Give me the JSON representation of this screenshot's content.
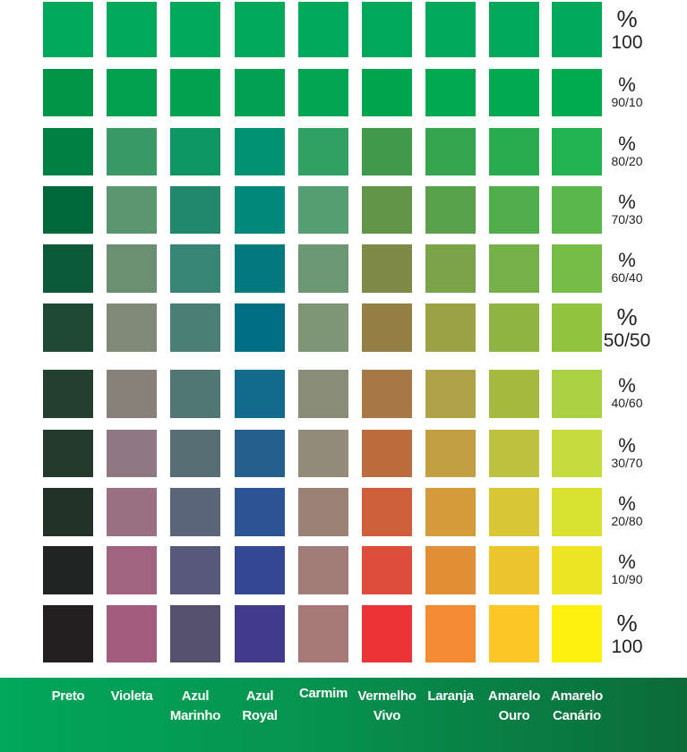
{
  "columns": [
    {
      "label_lines": [
        "Preto"
      ]
    },
    {
      "label_lines": [
        "Violeta"
      ]
    },
    {
      "label_lines": [
        "Azul",
        "Marinho"
      ]
    },
    {
      "label_lines": [
        "Azul",
        "Royal"
      ]
    },
    {
      "label_lines": [
        "Carmim"
      ]
    },
    {
      "label_lines": [
        "Vermelho",
        "Vivo"
      ]
    },
    {
      "label_lines": [
        "Laranja"
      ]
    },
    {
      "label_lines": [
        "Amarelo",
        "Ouro"
      ]
    },
    {
      "label_lines": [
        "Amarelo",
        "Canário"
      ]
    }
  ],
  "rows": [
    {
      "symbol": "%",
      "ratio": "100",
      "big": true,
      "colors": [
        "#00a859",
        "#00a859",
        "#00a859",
        "#00a859",
        "#00a859",
        "#00a859",
        "#00a859",
        "#00a859",
        "#00a859"
      ]
    },
    {
      "symbol": "%",
      "ratio": "90/10",
      "colors": [
        "#009447",
        "#00a04e",
        "#00a250",
        "#00a252",
        "#00a651",
        "#00a54f",
        "#00a84f",
        "#00a94f",
        "#00ab4e"
      ]
    },
    {
      "symbol": "%",
      "ratio": "80/20",
      "colors": [
        "#007f45",
        "#3a9966",
        "#0e9564",
        "#009270",
        "#30a063",
        "#3f9b4a",
        "#35a550",
        "#29ac4f",
        "#22b24f"
      ]
    },
    {
      "symbol": "%",
      "ratio": "70/30",
      "colors": [
        "#00693b",
        "#5a9770",
        "#22886b",
        "#00887a",
        "#55a070",
        "#639548",
        "#5aa14b",
        "#4fad4a",
        "#58b748"
      ]
    },
    {
      "symbol": "%",
      "ratio": "60/40",
      "colors": [
        "#0c5a38",
        "#6c8f74",
        "#378575",
        "#00787c",
        "#6a9873",
        "#7e8a45",
        "#7ba348",
        "#75b048",
        "#76bd46"
      ]
    },
    {
      "symbol": "%",
      "ratio": "50/50",
      "big": true,
      "colors": [
        "#1e4a33",
        "#7f8b78",
        "#4a7f76",
        "#006e82",
        "#7e9676",
        "#958044",
        "#9aa245",
        "#8fb443",
        "#92c442"
      ]
    },
    {
      "symbol": "%",
      "ratio": "40/60",
      "colors": [
        "#23402f",
        "#888178",
        "#507773",
        "#126b8c",
        "#8a8d76",
        "#a87844",
        "#afa247",
        "#a6ba42",
        "#abd043"
      ]
    },
    {
      "symbol": "%",
      "ratio": "30/70",
      "colors": [
        "#233a2d",
        "#8f7881",
        "#586e75",
        "#245f8d",
        "#948b78",
        "#bc6d3f",
        "#c2a042",
        "#bcc23d",
        "#c3dc3b"
      ]
    },
    {
      "symbol": "%",
      "ratio": "20/80",
      "colors": [
        "#22302a",
        "#9a7083",
        "#5a6579",
        "#2d5495",
        "#9c8276",
        "#cd603a",
        "#d49a3c",
        "#d8c636",
        "#d7e12f"
      ]
    },
    {
      "symbol": "%",
      "ratio": "10/90",
      "colors": [
        "#222424",
        "#a06480",
        "#57597a",
        "#334795",
        "#a27c78",
        "#dc4e3a",
        "#e18e34",
        "#ebc52c",
        "#eee624"
      ]
    },
    {
      "symbol": "%",
      "ratio": "100",
      "big": true,
      "colors": [
        "#231f20",
        "#a45b80",
        "#56506f",
        "#403b8c",
        "#a67878",
        "#ec3338",
        "#f48a32",
        "#fdc727",
        "#fff10f"
      ]
    }
  ]
}
